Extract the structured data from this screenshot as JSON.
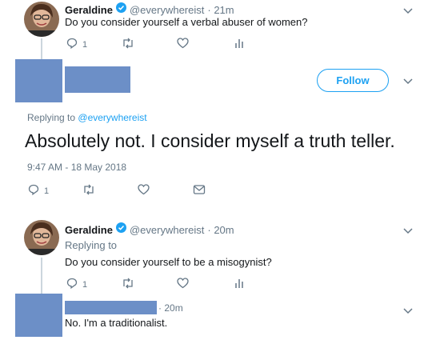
{
  "tweet1": {
    "name": "Geraldine",
    "handle": "@everywhereist",
    "time": "· 21m",
    "text": "Do you consider yourself a verbal abuser of women?",
    "reply_count": "1"
  },
  "main": {
    "follow_label": "Follow",
    "replying_prefix": "Replying to",
    "replying_handle": "@everywhereist",
    "text": "Absolutely not. I consider myself a truth teller.",
    "timestamp": "9:47 AM - 18 May 2018",
    "reply_count": "1"
  },
  "tweet2": {
    "name": "Geraldine",
    "handle": "@everywhereist",
    "time": "· 20m",
    "replying": "Replying to",
    "text": "Do you consider yourself to be a misogynist?",
    "reply_count": "1"
  },
  "reply": {
    "time": "20m",
    "text": "No. I'm a traditionalist."
  },
  "colors": {
    "accent": "#1da1f2",
    "redaction": "#6c8fc7",
    "verified": "#1da1f2"
  }
}
